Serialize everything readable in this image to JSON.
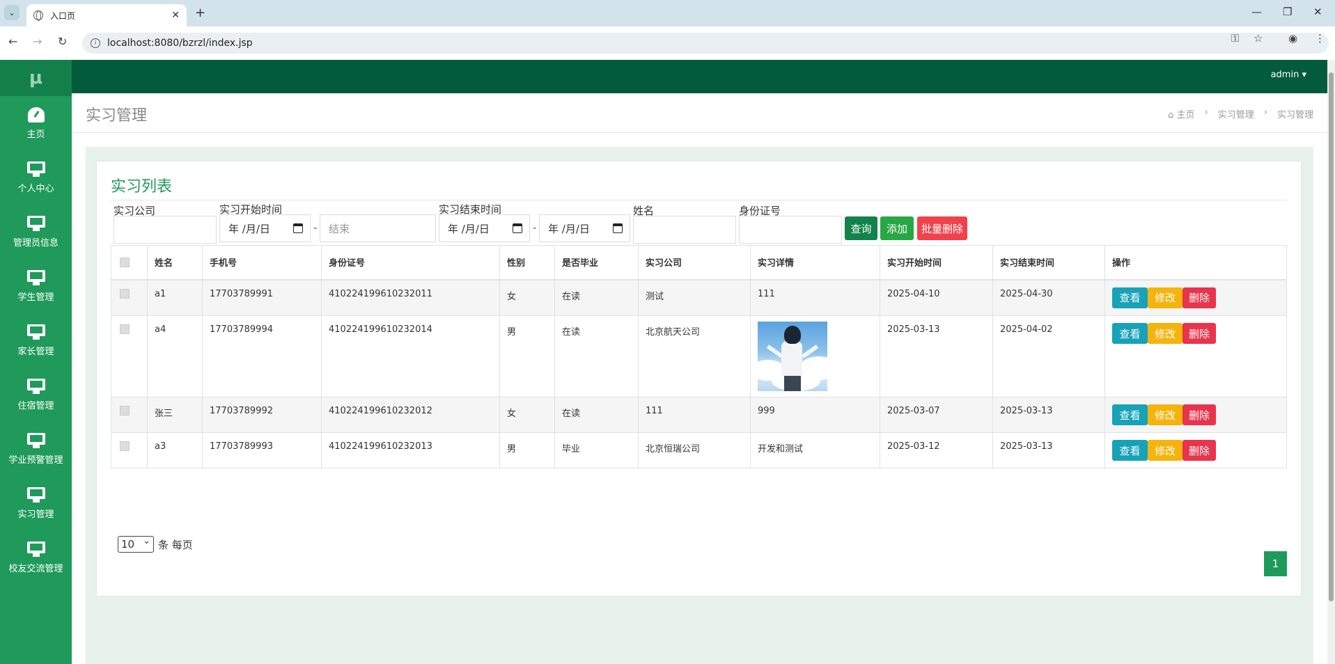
{
  "browser": {
    "tab_title": "入口页",
    "url": "localhost:8080/bzrzl/index.jsp"
  },
  "sidebar": {
    "logo": "μ",
    "items": [
      {
        "label": "主页",
        "icon": "dashboard-icon"
      },
      {
        "label": "个人中心",
        "icon": "monitor-icon"
      },
      {
        "label": "管理员信息",
        "icon": "monitor-icon"
      },
      {
        "label": "学生管理",
        "icon": "monitor-icon"
      },
      {
        "label": "家长管理",
        "icon": "monitor-icon"
      },
      {
        "label": "住宿管理",
        "icon": "monitor-icon"
      },
      {
        "label": "学业预警管理",
        "icon": "monitor-icon"
      },
      {
        "label": "实习管理",
        "icon": "monitor-icon"
      },
      {
        "label": "校友交流管理",
        "icon": "monitor-icon"
      }
    ]
  },
  "header": {
    "user": "admin",
    "page_title": "实习管理",
    "breadcrumb": [
      "主页",
      "实习管理",
      "实习管理"
    ]
  },
  "panel": {
    "title": "实习列表"
  },
  "filters": {
    "company_label": "实习公司",
    "company_value": "",
    "start_label": "实习开始时间",
    "start_from": "年 /月/日",
    "start_to_placeholder": "结束",
    "end_label": "实习结束时间",
    "end_from": "年 /月/日",
    "end_to": "年 /月/日",
    "separator": "-",
    "name_label": "姓名",
    "name_value": "",
    "id_label": "身份证号",
    "id_value": "",
    "search_btn": "查询",
    "add_btn": "添加",
    "batch_delete_btn": "批量删除"
  },
  "table": {
    "columns": [
      "姓名",
      "手机号",
      "身份证号",
      "性别",
      "是否毕业",
      "实习公司",
      "实习详情",
      "实习开始时间",
      "实习结束时间",
      "操作"
    ],
    "actions": {
      "view": "查看",
      "edit": "修改",
      "delete": "删除"
    },
    "rows": [
      {
        "name": "a1",
        "phone": "17703789991",
        "id": "410224199610232011",
        "gender": "女",
        "graduated": "在读",
        "company": "测试",
        "detail": "111",
        "start": "2025-04-10",
        "end": "2025-04-30"
      },
      {
        "name": "a4",
        "phone": "17703789994",
        "id": "410224199610232014",
        "gender": "男",
        "graduated": "在读",
        "company": "北京航天公司",
        "detail": "",
        "start": "2025-03-13",
        "end": "2025-04-02"
      },
      {
        "name": "张三",
        "phone": "17703789992",
        "id": "410224199610232012",
        "gender": "女",
        "graduated": "在读",
        "company": "111",
        "detail": "999",
        "start": "2025-03-07",
        "end": "2025-03-13"
      },
      {
        "name": "a3",
        "phone": "17703789993",
        "id": "410224199610232013",
        "gender": "男",
        "graduated": "毕业",
        "company": "北京恒瑞公司",
        "detail": "开发和测试",
        "start": "2025-03-12",
        "end": "2025-03-13"
      }
    ]
  },
  "pagination": {
    "page_size": "10",
    "page_size_suffix": "条 每页",
    "current_page": "1"
  },
  "colors": {
    "sidebar": "#1f9a5a",
    "topbar": "#015b3c",
    "accent": "#1f9a5a",
    "view": "#17a2b8",
    "edit": "#f5b40d",
    "delete": "#e8344c"
  }
}
